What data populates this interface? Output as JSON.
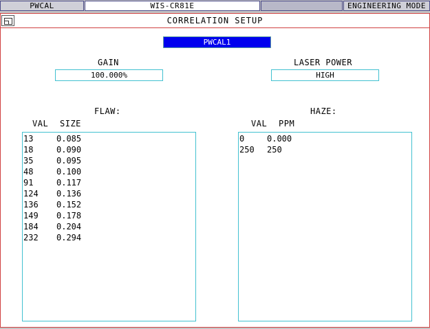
{
  "topbar": {
    "app_name": "PWCAL",
    "window_title": "WIS-CR81E",
    "mode": "ENGINEERING MODE"
  },
  "window": {
    "title": "CORRELATION SETUP",
    "profile": "PWCAL1"
  },
  "gain": {
    "label": "GAIN",
    "value": "100.000%"
  },
  "laser_power": {
    "label": "LASER POWER",
    "value": "HIGH"
  },
  "flaw": {
    "label": "FLAW:",
    "col_val": "VAL",
    "col_size": "SIZE",
    "rows": [
      [
        "13",
        "0.085"
      ],
      [
        "18",
        "0.090"
      ],
      [
        "35",
        "0.095"
      ],
      [
        "48",
        "0.100"
      ],
      [
        "91",
        "0.117"
      ],
      [
        "124",
        "0.136"
      ],
      [
        "136",
        "0.152"
      ],
      [
        "149",
        "0.178"
      ],
      [
        "184",
        "0.204"
      ],
      [
        "232",
        "0.294"
      ]
    ]
  },
  "haze": {
    "label": "HAZE:",
    "col_val": "VAL",
    "col_ppm": "PPM",
    "rows": [
      [
        "0",
        "0.000"
      ],
      [
        "250",
        "250"
      ]
    ]
  }
}
